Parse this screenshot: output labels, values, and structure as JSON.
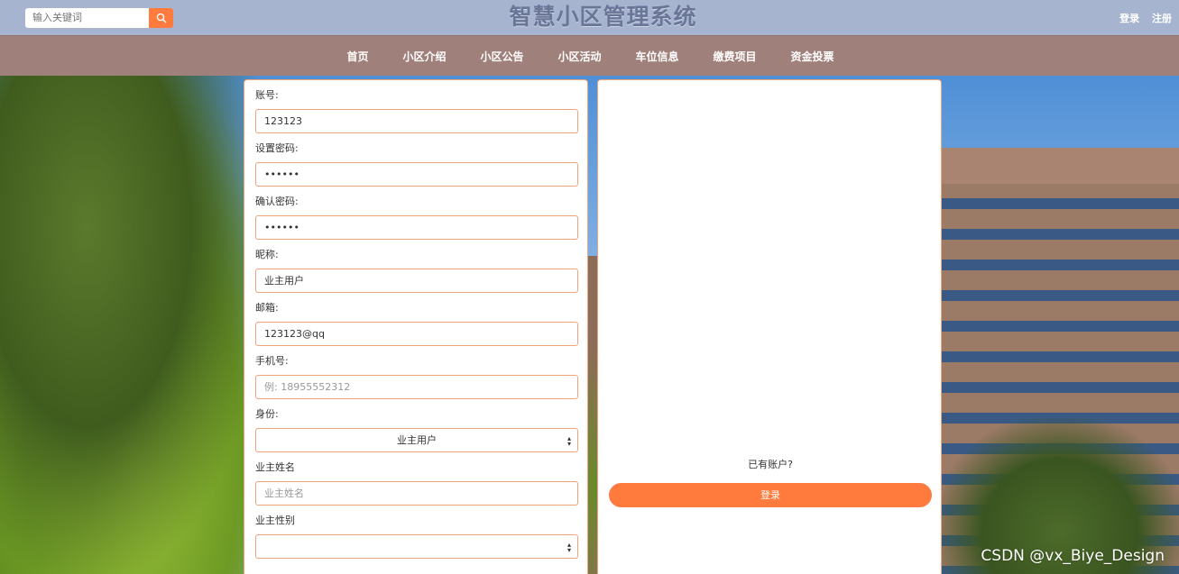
{
  "header": {
    "search_placeholder": "输入关键词",
    "site_title": "智慧小区管理系统",
    "login_link": "登录",
    "register_link": "注册"
  },
  "nav": {
    "items": [
      "首页",
      "小区介绍",
      "小区公告",
      "小区活动",
      "车位信息",
      "缴费项目",
      "资金投票"
    ]
  },
  "form": {
    "account_label": "账号:",
    "account_value": "123123",
    "password_label": "设置密码:",
    "password_value": "••••••",
    "confirm_label": "确认密码:",
    "confirm_value": "••••••",
    "nickname_label": "昵称:",
    "nickname_value": "业主用户",
    "email_label": "邮箱:",
    "email_value": "123123@qq",
    "phone_label": "手机号:",
    "phone_placeholder": "例: 18955552312",
    "role_label": "身份:",
    "role_value": "业主用户",
    "owner_name_label": "业主姓名",
    "owner_name_placeholder": "业主姓名",
    "owner_gender_label": "业主性别",
    "owner_gender_value": ""
  },
  "side": {
    "have_account": "已有账户?",
    "login_button": "登录"
  },
  "watermark": "CSDN @vx_Biye_Design",
  "colors": {
    "accent": "#ff7a3d",
    "topbar": "#a6b4d0",
    "navbar": "#a0807a"
  }
}
